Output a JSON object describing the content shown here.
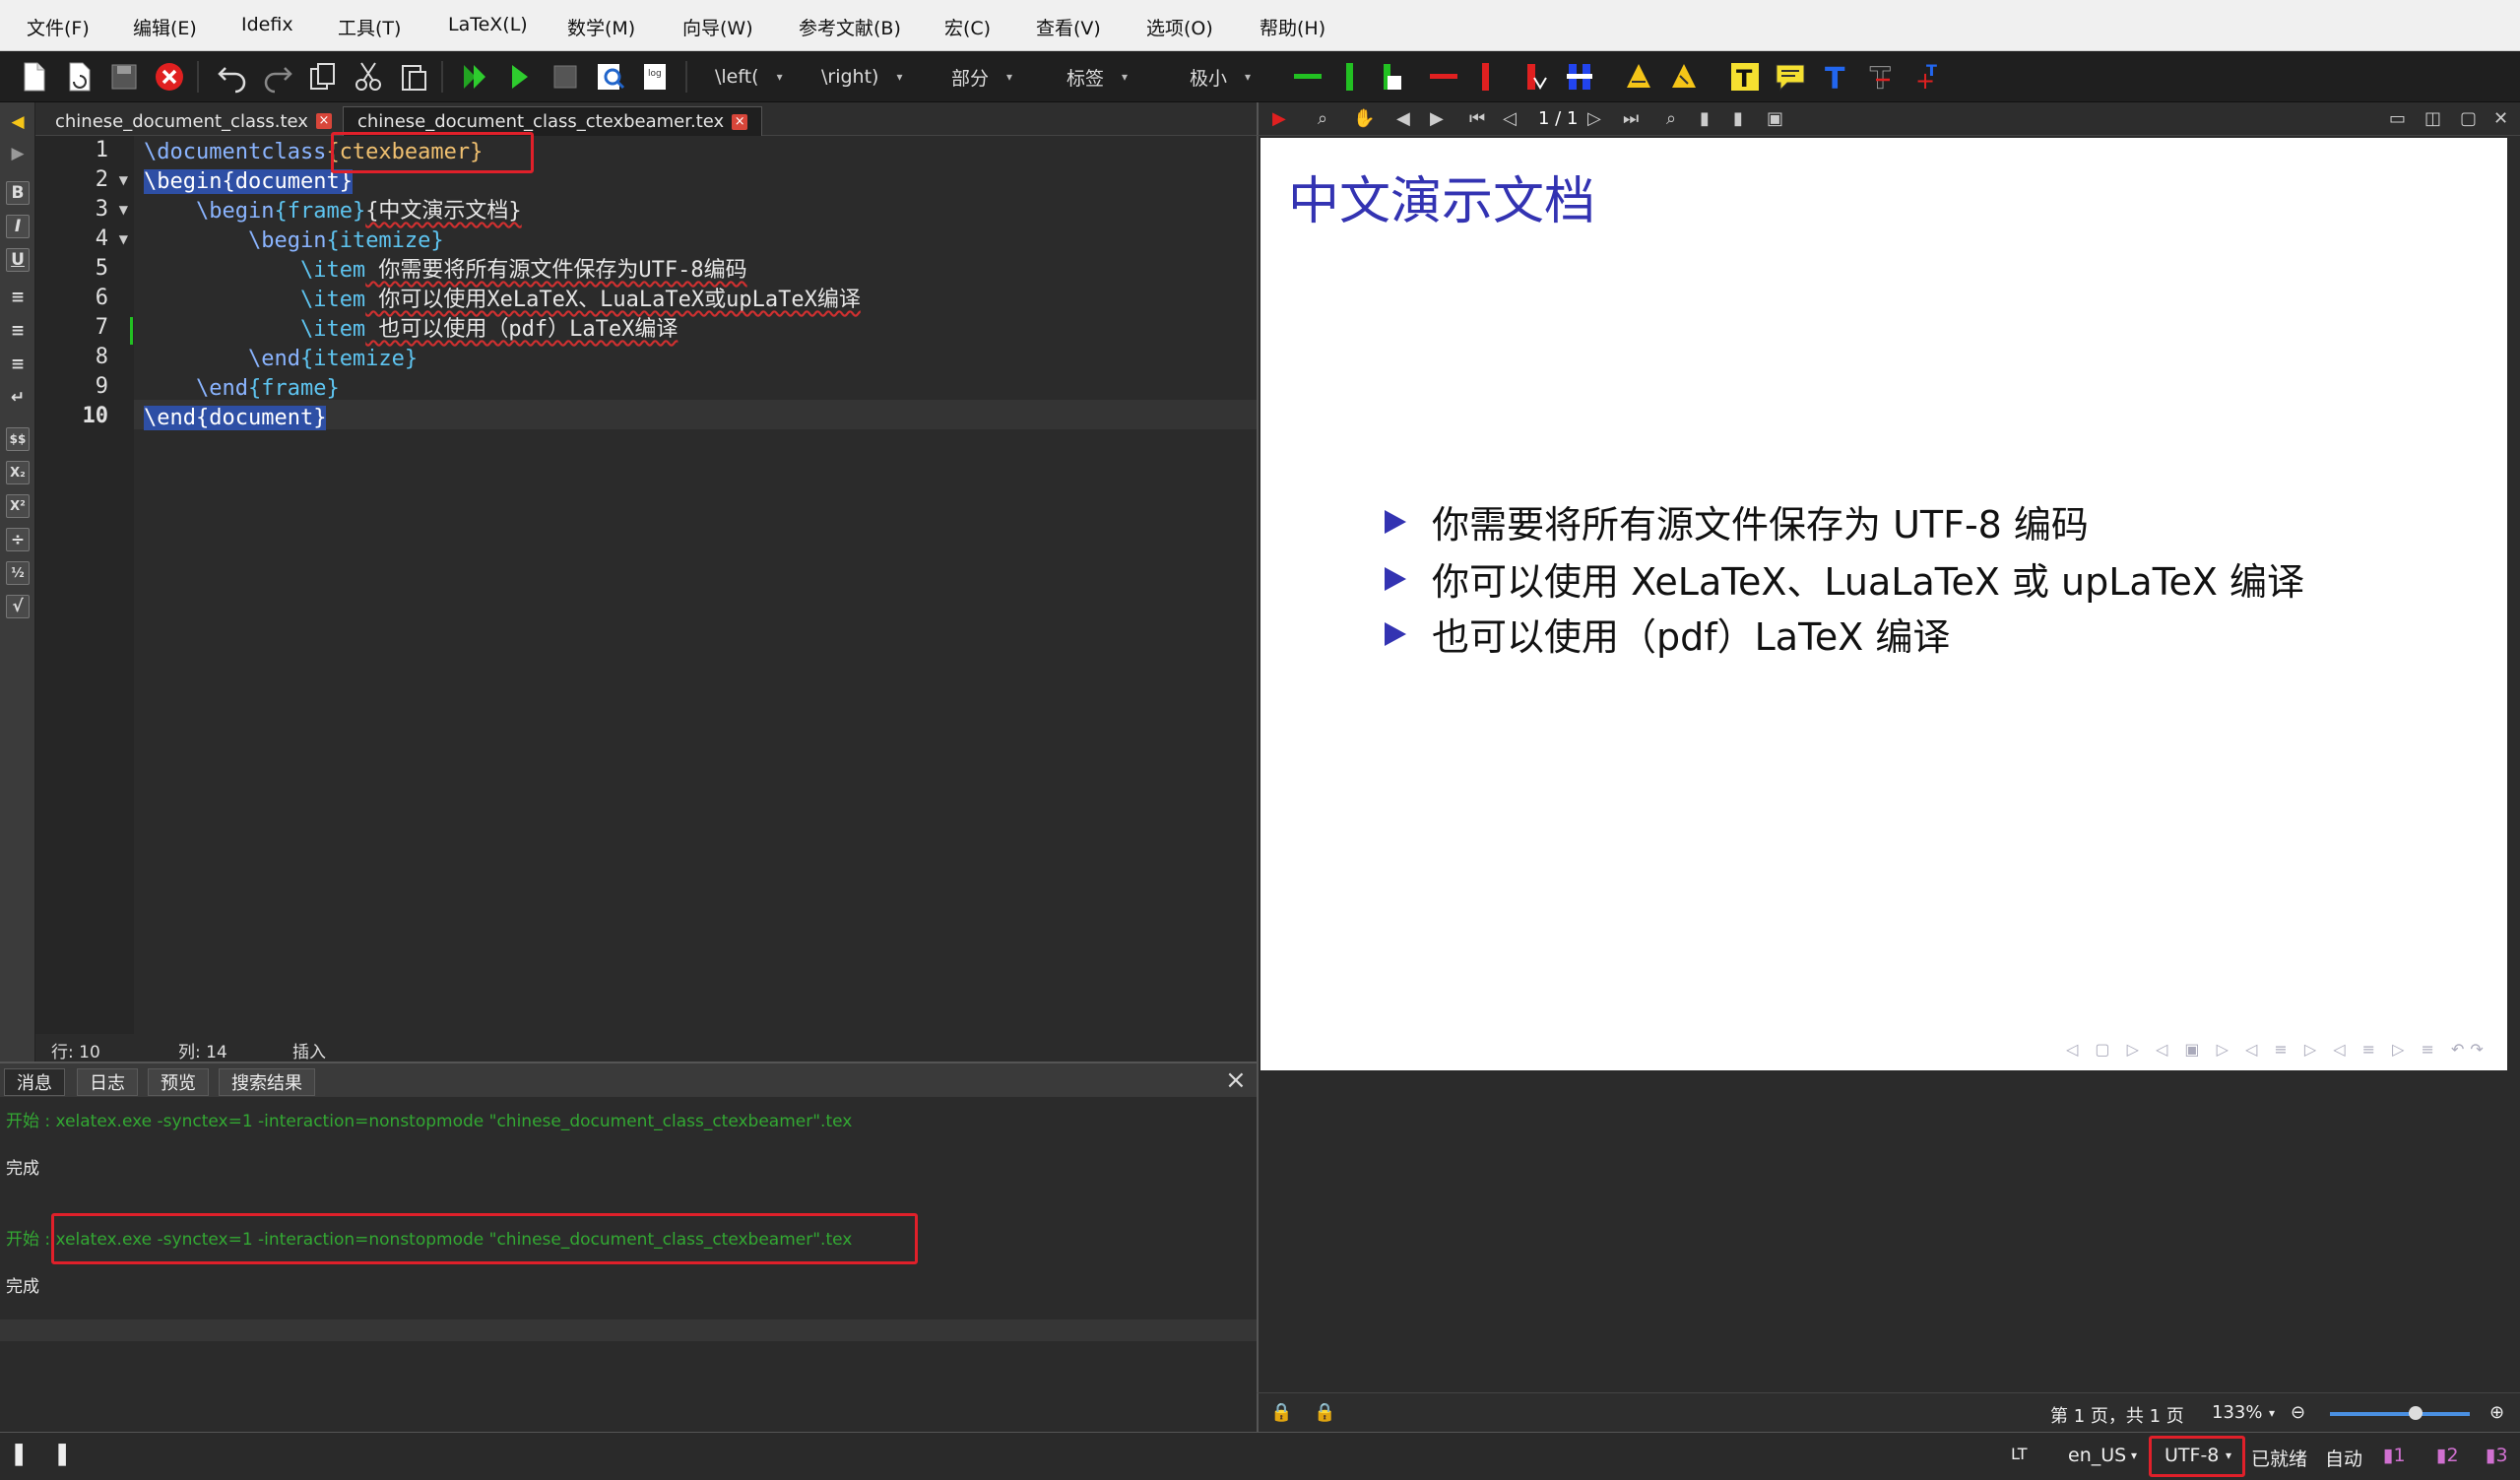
{
  "menu": [
    "文件(F)",
    "编辑(E)",
    "Idefix",
    "工具(T)",
    "LaTeX(L)",
    "数学(M)",
    "向导(W)",
    "参考文献(B)",
    "宏(C)",
    "查看(V)",
    "选项(O)",
    "帮助(H)"
  ],
  "toolbar": {
    "left_combo": "\\left(",
    "right_combo": "\\right)",
    "section_combo": "部分",
    "label_combo": "标签",
    "size_combo": "极小"
  },
  "tabs": [
    {
      "label": "chinese_document_class.tex"
    },
    {
      "label": "chinese_document_class_ctexbeamer.tex"
    }
  ],
  "editor": {
    "line_numbers": [
      "1",
      "2",
      "3",
      "4",
      "5",
      "6",
      "7",
      "8",
      "9",
      "10"
    ],
    "lines": [
      {
        "cmd": "\\documentclass",
        "arg": "{ctexbeamer}"
      },
      {
        "cmd": "\\begin",
        "arg": "{document}"
      },
      {
        "indent": "    ",
        "cmd": "\\begin",
        "arg": "{frame}",
        "text": "{中文演示文档}"
      },
      {
        "indent": "        ",
        "cmd": "\\begin",
        "arg": "{itemize}"
      },
      {
        "indent": "            ",
        "cmd": "\\item",
        "text": " 你需要将所有源文件保存为UTF-8编码"
      },
      {
        "indent": "            ",
        "cmd": "\\item",
        "text": " 你可以使用XeLaTeX、LuaLaTeX或upLaTeX编译"
      },
      {
        "indent": "            ",
        "cmd": "\\item",
        "text": " 也可以使用（pdf）LaTeX编译"
      },
      {
        "indent": "        ",
        "cmd": "\\end",
        "arg": "{itemize}"
      },
      {
        "indent": "    ",
        "cmd": "\\end",
        "arg": "{frame}"
      },
      {
        "cmd": "\\end",
        "arg": "{document}"
      }
    ],
    "status_row_label": "行: 10",
    "status_col_label": "列: 14",
    "status_mode": "插入"
  },
  "panel": {
    "tabs": [
      "消息",
      "日志",
      "预览",
      "搜索结果"
    ],
    "log": [
      {
        "text": "开始 : xelatex.exe -synctex=1 -interaction=nonstopmode \"chinese_document_class_ctexbeamer\".tex",
        "color": "green"
      },
      {
        "text": "完成",
        "color": "white"
      },
      {
        "text": "开始 : xelatex.exe -synctex=1 -interaction=nonstopmode \"chinese_document_class_ctexbeamer\".tex",
        "color": "green"
      },
      {
        "text": "完成",
        "color": "white"
      }
    ]
  },
  "viewer": {
    "page_indicator": "1 / 1",
    "slide_title": "中文演示文档",
    "bullets": [
      "你需要将所有源文件保存为 UTF-8 编码",
      "你可以使用 XeLaTeX、LuaLaTeX 或 upLaTeX 编译",
      "也可以使用（pdf）LaTeX 编译"
    ],
    "page_status": "第 1 页，共 1 页",
    "zoom": "133%",
    "theme_color": "#3333b2"
  },
  "statusbar": {
    "language": "en_US",
    "encoding": "UTF-8",
    "ready": "已就绪",
    "auto": "自动"
  }
}
